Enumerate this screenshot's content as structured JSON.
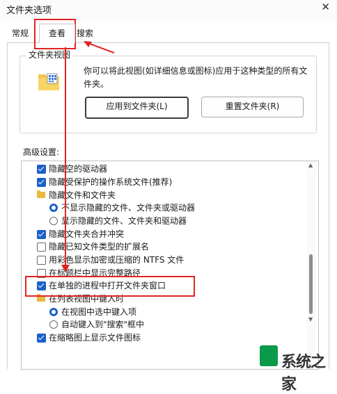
{
  "window": {
    "title": "文件夹选项",
    "close_glyph": "✕"
  },
  "tabs": [
    {
      "label": "常规"
    },
    {
      "label": "查看"
    },
    {
      "label": "搜索"
    }
  ],
  "folder_views": {
    "group_title": "文件夹视图",
    "description": "你可以将此视图(如详细信息或图标)应用于这种类型的所有文件夹。",
    "apply_button": "应用到文件夹(L)",
    "reset_button": "重置文件夹(R)"
  },
  "advanced": {
    "label": "高级设置:",
    "items": [
      {
        "kind": "checkbox",
        "checked": true,
        "label": "隐藏空的驱动器"
      },
      {
        "kind": "checkbox",
        "checked": true,
        "label": "隐藏受保护的操作系统文件(推荐)"
      },
      {
        "kind": "folder",
        "label": "隐藏文件和文件夹"
      },
      {
        "kind": "radio",
        "checked": true,
        "label": "不显示隐藏的文件、文件夹或驱动器"
      },
      {
        "kind": "radio",
        "checked": false,
        "label": "显示隐藏的文件、文件夹和驱动器"
      },
      {
        "kind": "checkbox",
        "checked": true,
        "label": "隐藏文件夹合并冲突"
      },
      {
        "kind": "checkbox",
        "checked": false,
        "label": "隐藏已知文件类型的扩展名"
      },
      {
        "kind": "checkbox",
        "checked": false,
        "label": "用彩色显示加密或压缩的 NTFS 文件"
      },
      {
        "kind": "checkbox",
        "checked": false,
        "label": "在标题栏中显示完整路径"
      },
      {
        "kind": "checkbox",
        "checked": true,
        "label": "在单独的进程中打开文件夹窗口"
      },
      {
        "kind": "folder",
        "label": "在列表视图中键入时"
      },
      {
        "kind": "radio",
        "checked": true,
        "label": "在视图中选中键入项"
      },
      {
        "kind": "radio",
        "checked": false,
        "label": "自动键入到\"搜索\"框中"
      },
      {
        "kind": "checkbox",
        "checked": true,
        "label": "在缩略图上显示文件图标"
      }
    ]
  },
  "colors": {
    "accent": "#1b60c9",
    "annotation": "#e02424",
    "folder": "#e8b93c"
  },
  "watermark": {
    "text": "系统之家"
  }
}
